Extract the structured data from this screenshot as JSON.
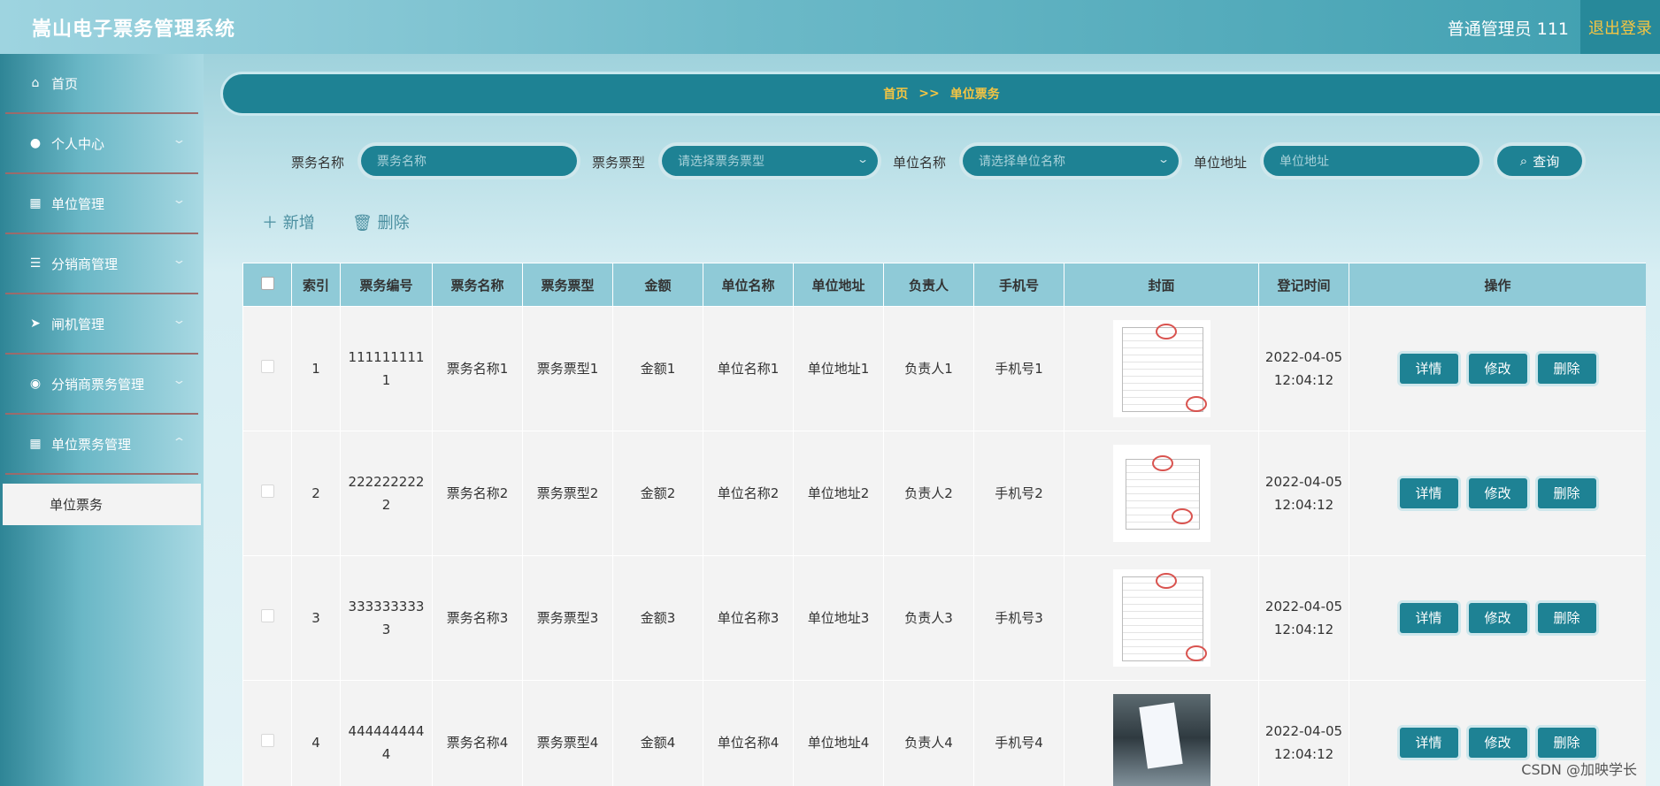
{
  "app": {
    "title": "嵩山电子票务管理系统",
    "user": "普通管理员 111",
    "logout": "退出登录"
  },
  "sidebar": {
    "items": [
      {
        "label": "首页",
        "icon": "home-icon"
      },
      {
        "label": "个人中心",
        "icon": "user-icon"
      },
      {
        "label": "单位管理",
        "icon": "grid-icon"
      },
      {
        "label": "分销商管理",
        "icon": "list-icon"
      },
      {
        "label": "闸机管理",
        "icon": "send-icon"
      },
      {
        "label": "分销商票务管理",
        "icon": "location-icon"
      },
      {
        "label": "单位票务管理",
        "icon": "grid-icon"
      }
    ],
    "sub_item": "单位票务"
  },
  "breadcrumb": {
    "home": "首页",
    "sep": ">>",
    "current": "单位票务"
  },
  "search": {
    "name_label": "票务名称",
    "name_placeholder": "票务名称",
    "type_label": "票务票型",
    "type_placeholder": "请选择票务票型",
    "unit_label": "单位名称",
    "unit_placeholder": "请选择单位名称",
    "addr_label": "单位地址",
    "addr_placeholder": "单位地址",
    "query_button": "查询"
  },
  "actions": {
    "add": "新增",
    "delete": "删除"
  },
  "table": {
    "headers": [
      "索引",
      "票务编号",
      "票务名称",
      "票务票型",
      "金额",
      "单位名称",
      "单位地址",
      "负责人",
      "手机号",
      "封面",
      "登记时间",
      "操作"
    ],
    "rows": [
      {
        "index": "1",
        "code": "1111111111",
        "name": "票务名称1",
        "type": "票务票型1",
        "amount": "金额1",
        "unit": "单位名称1",
        "addr": "单位地址1",
        "owner": "负责人1",
        "phone": "手机号1",
        "time": "2022-04-05 12:04:12"
      },
      {
        "index": "2",
        "code": "2222222222",
        "name": "票务名称2",
        "type": "票务票型2",
        "amount": "金额2",
        "unit": "单位名称2",
        "addr": "单位地址2",
        "owner": "负责人2",
        "phone": "手机号2",
        "time": "2022-04-05 12:04:12"
      },
      {
        "index": "3",
        "code": "3333333333",
        "name": "票务名称3",
        "type": "票务票型3",
        "amount": "金额3",
        "unit": "单位名称3",
        "addr": "单位地址3",
        "owner": "负责人3",
        "phone": "手机号3",
        "time": "2022-04-05 12:04:12"
      },
      {
        "index": "4",
        "code": "4444444444",
        "name": "票务名称4",
        "type": "票务票型4",
        "amount": "金额4",
        "unit": "单位名称4",
        "addr": "单位地址4",
        "owner": "负责人4",
        "phone": "手机号4",
        "time": "2022-04-05 12:04:12"
      }
    ],
    "row_buttons": {
      "detail": "详情",
      "edit": "修改",
      "delete": "删除"
    }
  },
  "watermark": "CSDN @加映学长"
}
